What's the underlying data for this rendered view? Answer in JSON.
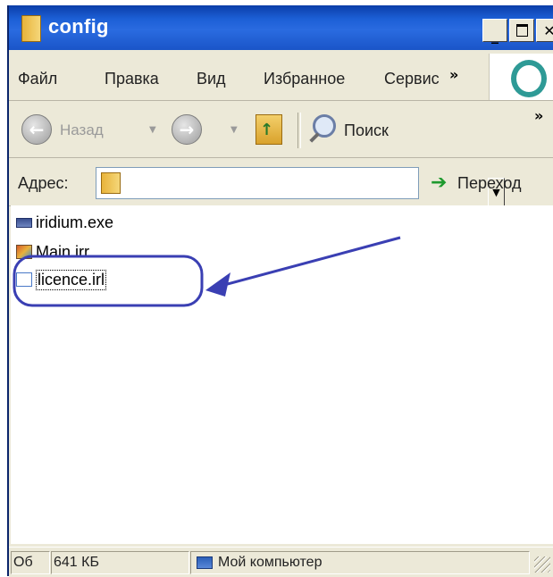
{
  "window": {
    "title": "config"
  },
  "menu": {
    "items": [
      "Файл",
      "Правка",
      "Вид",
      "Избранное",
      "Сервис"
    ],
    "overflow": "»"
  },
  "toolbar": {
    "back_label": "Назад",
    "search_label": "Поиск",
    "overflow": "»"
  },
  "address": {
    "label": "Адрес:",
    "value": "",
    "go_label": "Переход"
  },
  "files": [
    {
      "name": "iridium.exe",
      "icon": "exe-icon"
    },
    {
      "name": "Main.irr",
      "icon": "irr-icon"
    },
    {
      "name": "licence.irl",
      "icon": "irl-icon",
      "selected": true
    }
  ],
  "annotation": {
    "color": "#3a3fb3"
  },
  "status": {
    "objects": "Об",
    "size": "641 КБ",
    "location": "Мой компьютер"
  }
}
